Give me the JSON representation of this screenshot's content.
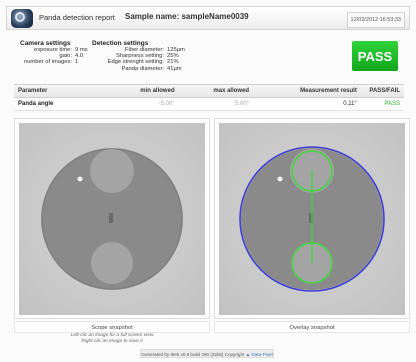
{
  "header": {
    "title": "Panda detection report",
    "sample": "Sample name: sampleName0039",
    "datetime": "12/03/2012 16:53:33"
  },
  "camera_settings": {
    "title": "Camera settings",
    "rows": [
      {
        "key": "exposure time:",
        "value": "9 ms"
      },
      {
        "key": "gain:",
        "value": "4.0"
      },
      {
        "key": "number of images:",
        "value": "1"
      }
    ]
  },
  "detection_settings": {
    "title": "Detection settings",
    "rows": [
      {
        "key": "Fiber diameter:",
        "value": "125µm"
      },
      {
        "key": "Sharpness setting:",
        "value": "25%"
      },
      {
        "key": "Edge strenght setting:",
        "value": "21%"
      },
      {
        "key": "Panda diameter:",
        "value": "41µm"
      }
    ]
  },
  "result_badge": "PASS",
  "table": {
    "headers": [
      "Parameter",
      "min allowed",
      "max allowed",
      "Measurement result",
      "PASS/FAIL"
    ],
    "rows": [
      {
        "parameter": "Panda angle",
        "min": "-5.00°",
        "max": "5.00°",
        "result": "0.11°",
        "status": "PASS"
      }
    ]
  },
  "scope_caption": "Scope snapshot",
  "overlay_caption": "Overlay snapshot",
  "hints": [
    "Left-clic an image for a full screen view",
    "Right-clic an image to save it"
  ],
  "footer": {
    "text": "Generated by 8tek v0.9 build 280 (32bit) Copyright",
    "brand": "Data-Pixel"
  },
  "colors": {
    "pass_green": "#18b524",
    "overlay_circle_blue": "#3b3fd1",
    "overlay_detect_green": "#33dd33"
  }
}
